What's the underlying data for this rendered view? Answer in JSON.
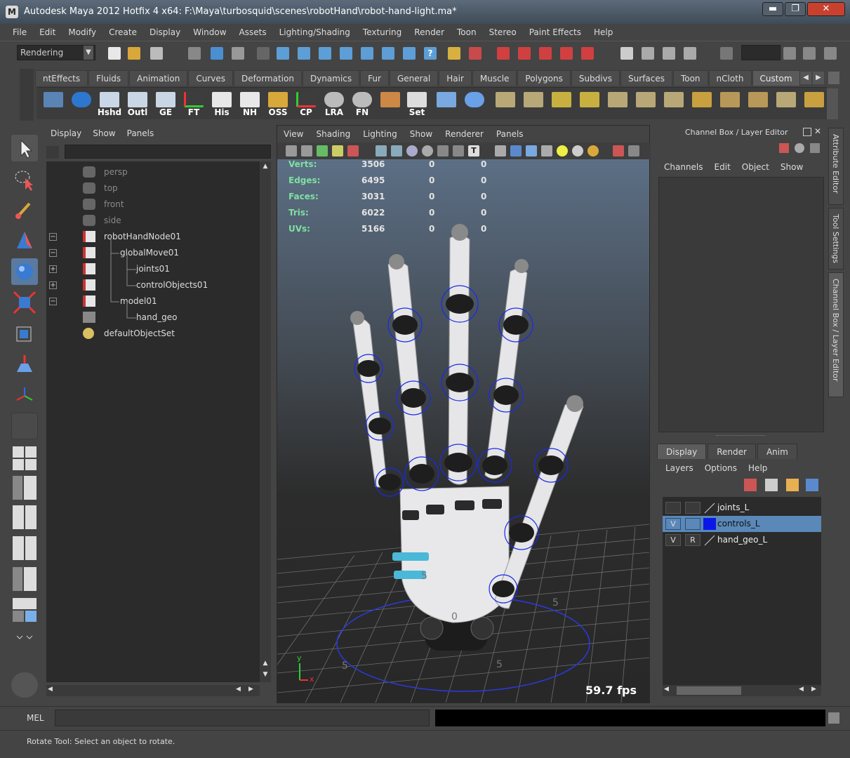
{
  "window": {
    "title": "Autodesk Maya 2012 Hotfix 4 x64: F:\\Maya\\turbosquid\\scenes\\robotHand\\robot-hand-light.ma*",
    "minimize": "▬",
    "maximize": "❐",
    "close": "✕"
  },
  "menubar": [
    "File",
    "Edit",
    "Modify",
    "Create",
    "Display",
    "Window",
    "Assets",
    "Lighting/Shading",
    "Texturing",
    "Render",
    "Toon",
    "Stereo",
    "Paint Effects",
    "Help"
  ],
  "statusline": {
    "mode": "Rendering"
  },
  "shelf": {
    "tabs": [
      "ntEffects",
      "Fluids",
      "Animation",
      "Curves",
      "Deformation",
      "Dynamics",
      "Fur",
      "General",
      "Hair",
      "Muscle",
      "Polygons",
      "Subdivs",
      "Surfaces",
      "Toon",
      "nCloth",
      "Custom"
    ],
    "active_tab": "Custom",
    "buttons": [
      "Hshd",
      "Outl",
      "GE",
      "FT",
      "His",
      "NH",
      "OSS",
      "CP",
      "LRA",
      "FN",
      "",
      "Set"
    ]
  },
  "outliner": {
    "menu": [
      "Display",
      "Show",
      "Panels"
    ],
    "items": [
      {
        "label": "persp",
        "expander": "",
        "dim": true
      },
      {
        "label": "top",
        "expander": "",
        "dim": true
      },
      {
        "label": "front",
        "expander": "",
        "dim": true
      },
      {
        "label": "side",
        "expander": "",
        "dim": true
      },
      {
        "label": "robotHandNode01",
        "expander": "−",
        "dim": false
      },
      {
        "label": "globalMove01",
        "expander": "−",
        "dim": false
      },
      {
        "label": "joints01",
        "expander": "+",
        "dim": false
      },
      {
        "label": "controlObjects01",
        "expander": "+",
        "dim": false
      },
      {
        "label": "model01",
        "expander": "−",
        "dim": false
      },
      {
        "label": "hand_geo",
        "expander": "",
        "dim": false
      },
      {
        "label": "defaultObjectSet",
        "expander": "",
        "dim": false
      }
    ]
  },
  "viewport": {
    "menu": [
      "View",
      "Shading",
      "Lighting",
      "Show",
      "Renderer",
      "Panels"
    ],
    "hud": [
      {
        "label": "Verts:",
        "v1": "3506",
        "v2": "0",
        "v3": "0"
      },
      {
        "label": "Edges:",
        "v1": "6495",
        "v2": "0",
        "v3": "0"
      },
      {
        "label": "Faces:",
        "v1": "3031",
        "v2": "0",
        "v3": "0"
      },
      {
        "label": "Tris:",
        "v1": "6022",
        "v2": "0",
        "v3": "0"
      },
      {
        "label": "UVs:",
        "v1": "5166",
        "v2": "0",
        "v3": "0"
      }
    ],
    "fps": "59.7 fps",
    "axis_y": "y",
    "axis_x": "x",
    "grid_labels": [
      "5",
      "5",
      "5",
      "5",
      "0"
    ]
  },
  "channelbox": {
    "title": "Channel Box / Layer Editor",
    "menu": [
      "Channels",
      "Edit",
      "Object",
      "Show"
    ],
    "layer_tabs": [
      "Display",
      "Render",
      "Anim"
    ],
    "active_layer_tab": "Display",
    "layer_menu": [
      "Layers",
      "Options",
      "Help"
    ],
    "layers": [
      {
        "name": "joints_L",
        "v": "",
        "r": "",
        "color": "",
        "selected": false
      },
      {
        "name": "controls_L",
        "v": "V",
        "r": "",
        "color": "#0a18e6",
        "selected": true
      },
      {
        "name": "hand_geo_L",
        "v": "V",
        "r": "R",
        "color": "",
        "selected": false
      }
    ]
  },
  "sidetabs": [
    "Attribute Editor",
    "Tool Settings",
    "Channel Box / Layer Editor"
  ],
  "commandline": {
    "label": "MEL"
  },
  "helpline": {
    "text": "Rotate Tool: Select an object to rotate."
  }
}
